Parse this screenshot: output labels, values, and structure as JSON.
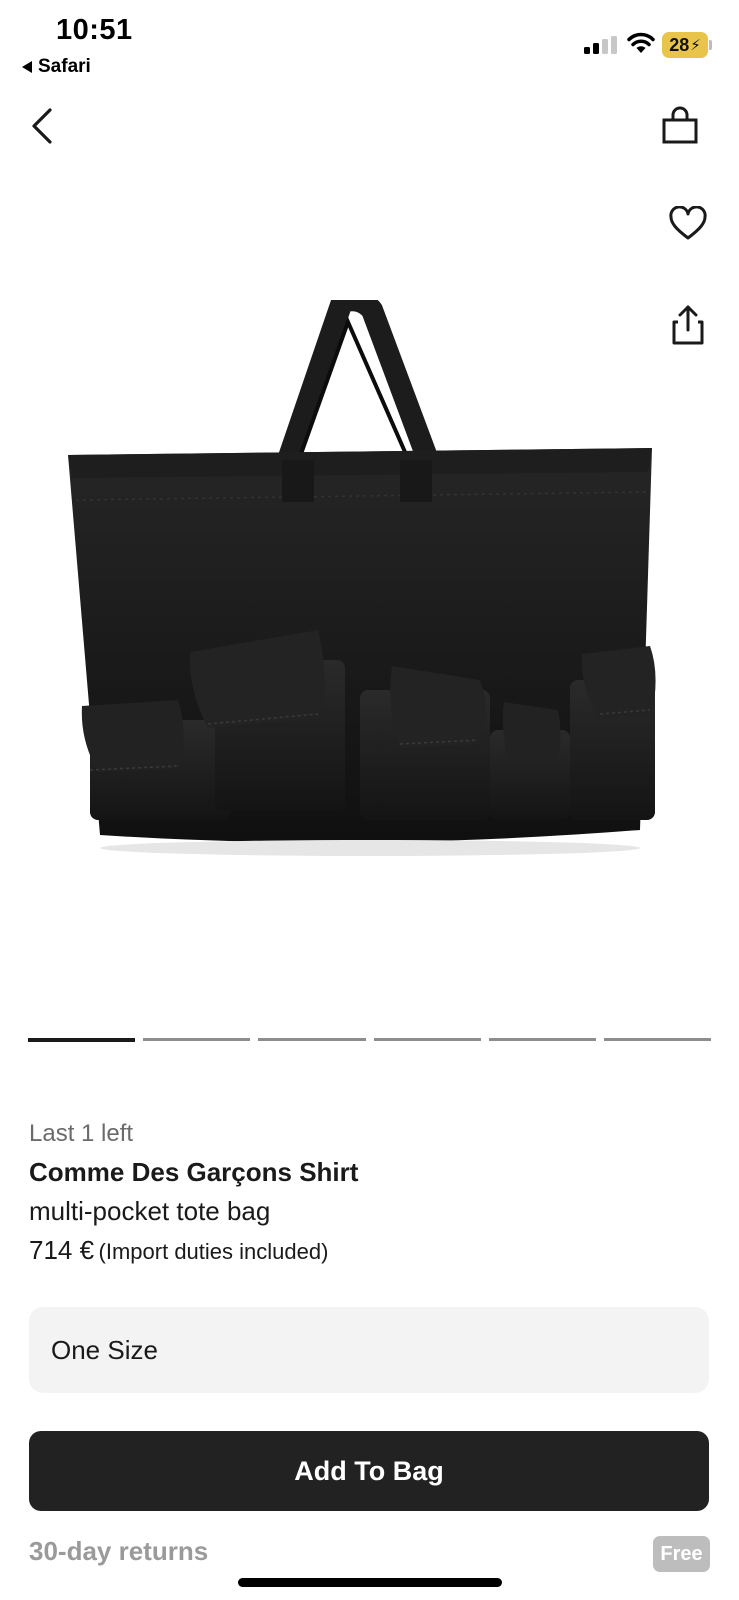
{
  "status_bar": {
    "time": "10:51",
    "back_app": "Safari",
    "battery": "28",
    "battery_color": "#e8c54a"
  },
  "nav": {
    "back_icon": "chevron-left-icon",
    "bag_icon": "shopping-bag-icon",
    "heart_icon": "heart-icon",
    "share_icon": "share-icon"
  },
  "carousel": {
    "total": 6,
    "active_index": 0
  },
  "product": {
    "stock": "Last 1 left",
    "brand": "Comme Des Garçons Shirt",
    "name": "multi-pocket tote bag",
    "price": "714 €",
    "duties": "(Import duties included)"
  },
  "size": {
    "selected": "One Size"
  },
  "actions": {
    "add_to_bag": "Add To Bag"
  },
  "returns": {
    "label": "30-day returns",
    "badge": "Free"
  },
  "colors": {
    "button_bg": "#222222",
    "select_bg": "#f3f3f3"
  }
}
